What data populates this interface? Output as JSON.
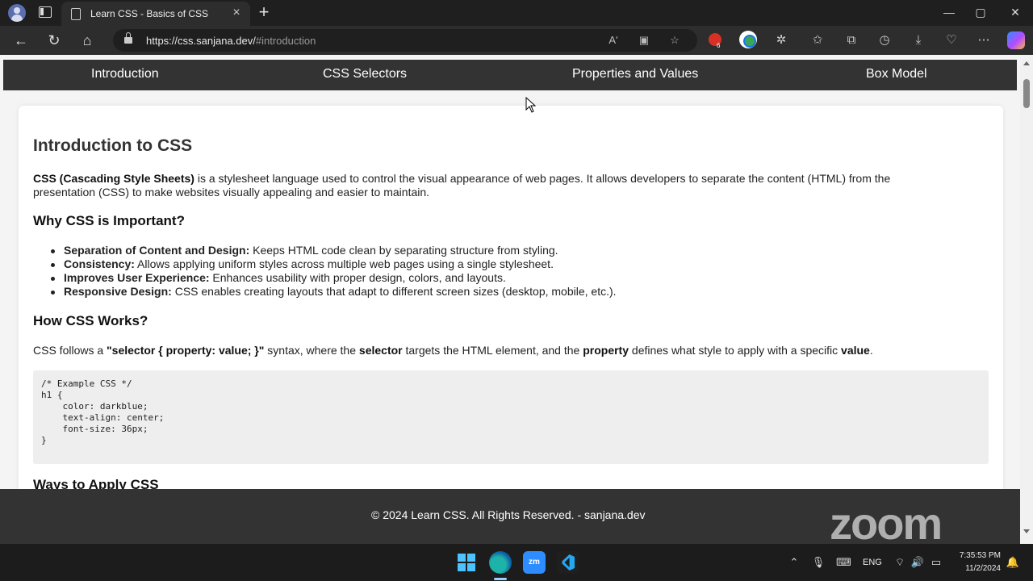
{
  "browser": {
    "tab_title": "Learn CSS - Basics of CSS",
    "new_tab_symbol": "+",
    "close_tab_symbol": "×",
    "url_host": "https://css.sanjana.dev/",
    "url_hash": "#introduction",
    "read_aloud_symbol": "Aʹ",
    "extension_badge": "6",
    "window_buttons": {
      "minimize": "—",
      "maximize": "▢",
      "close": "✕"
    }
  },
  "site": {
    "nav": [
      "Introduction",
      "CSS Selectors",
      "Properties and Values",
      "Box Model"
    ],
    "heading": "Introduction to CSS",
    "intro_bold": "CSS (Cascading Style Sheets)",
    "intro_rest_line1": " is a stylesheet language used to control the visual appearance of web pages. It allows developers to separate the content (HTML) from the",
    "intro_line2": "presentation (CSS) to make websites visually appealing and easier to maintain.",
    "why_heading": "Why CSS is Important?",
    "bullets": [
      {
        "bold": "Separation of Content and Design:",
        "text": " Keeps HTML code clean by separating structure from styling."
      },
      {
        "bold": "Consistency:",
        "text": " Allows applying uniform styles across multiple web pages using a single stylesheet."
      },
      {
        "bold": "Improves User Experience:",
        "text": " Enhances usability with proper design, colors, and layouts."
      },
      {
        "bold": "Responsive Design:",
        "text": " CSS enables creating layouts that adapt to different screen sizes (desktop, mobile, etc.)."
      }
    ],
    "how_heading": "How CSS Works?",
    "how_text": {
      "t1": "CSS follows a ",
      "b1": "\"selector { property: value; }\"",
      "t2": " syntax, where the ",
      "b2": "selector",
      "t3": " targets the HTML element, and the ",
      "b3": "property",
      "t4": " defines what style to apply with a specific ",
      "b4": "value",
      "t5": "."
    },
    "code_lines": [
      "/* Example CSS */",
      "h1 {",
      "    color: darkblue;",
      "    text-align: center;",
      "    font-size: 36px;",
      "}"
    ],
    "next_heading": "Ways to Apply CSS",
    "footer": "© 2024 Learn CSS. All Rights Reserved. - sanjana.dev"
  },
  "overlay": {
    "watermark": "zoom"
  },
  "taskbar": {
    "zoom_app_label": "zm",
    "language": "ENG",
    "time": "7:35:53 PM",
    "date": "11/2/2024"
  }
}
